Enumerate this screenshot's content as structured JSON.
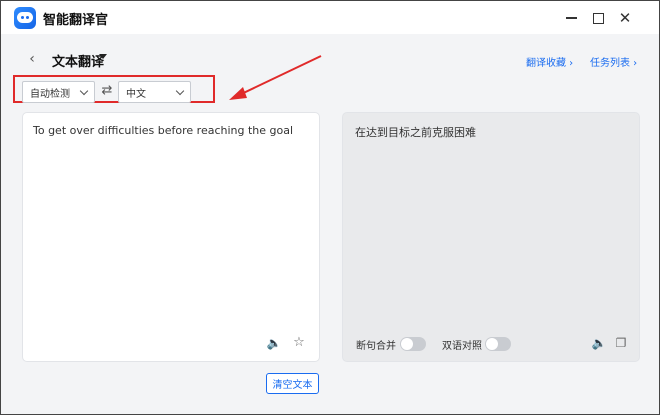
{
  "window": {
    "title": "智能翻译官",
    "minimize": "minimize",
    "maximize": "maximize",
    "close": "✕"
  },
  "header": {
    "back": "‹",
    "mode_title": "文本翻译",
    "links": {
      "favorites": "翻译收藏 ›",
      "tasks": "任务列表 ›"
    }
  },
  "languages": {
    "source": "自动检测",
    "target": "中文",
    "swap": "⇄"
  },
  "source_panel": {
    "text": "To get over difficulties before reaching the goal",
    "speaker": "🔈",
    "star": "☆"
  },
  "result_panel": {
    "text": "在达到目标之前克服困难",
    "merge_label": "断句合并",
    "bilingual_label": "双语对照",
    "merge_on": false,
    "bilingual_on": false,
    "speaker": "🔈",
    "copy": "❐"
  },
  "actions": {
    "clear": "清空文本"
  },
  "colors": {
    "accent": "#1a6cf0",
    "highlight": "#e02a2a"
  }
}
